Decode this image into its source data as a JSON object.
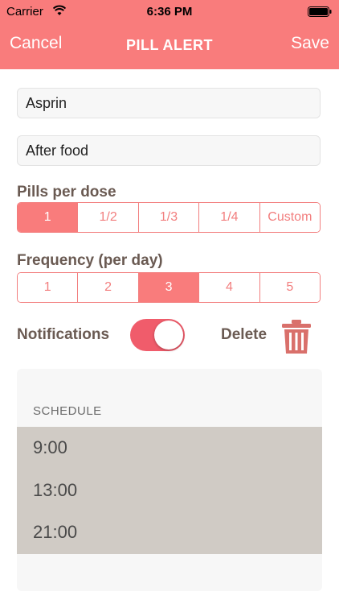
{
  "status_bar": {
    "carrier": "Carrier",
    "time": "6:36 PM"
  },
  "nav": {
    "cancel_label": "Cancel",
    "title": "PILL ALERT",
    "save_label": "Save"
  },
  "form": {
    "name_value": "Asprin",
    "instructions_value": "After food"
  },
  "pills_per_dose": {
    "label": "Pills per dose",
    "options": [
      "1",
      "1/2",
      "1/3",
      "1/4",
      "Custom"
    ],
    "selected": "1"
  },
  "frequency": {
    "label": "Frequency (per day)",
    "options": [
      "1",
      "2",
      "3",
      "4",
      "5"
    ],
    "selected": "3"
  },
  "notifications": {
    "label": "Notifications",
    "enabled": true
  },
  "delete": {
    "label": "Delete"
  },
  "schedule": {
    "header": "SCHEDULE",
    "times": [
      "9:00",
      "13:00",
      "21:00"
    ]
  },
  "colors": {
    "accent": "#f97c7c",
    "label_text": "#6a5a52",
    "trash": "#d9706b",
    "schedule_bg": "#d0cbc5"
  },
  "icons": {
    "wifi": "wifi-icon",
    "battery": "battery-icon",
    "trash": "trash-icon"
  }
}
